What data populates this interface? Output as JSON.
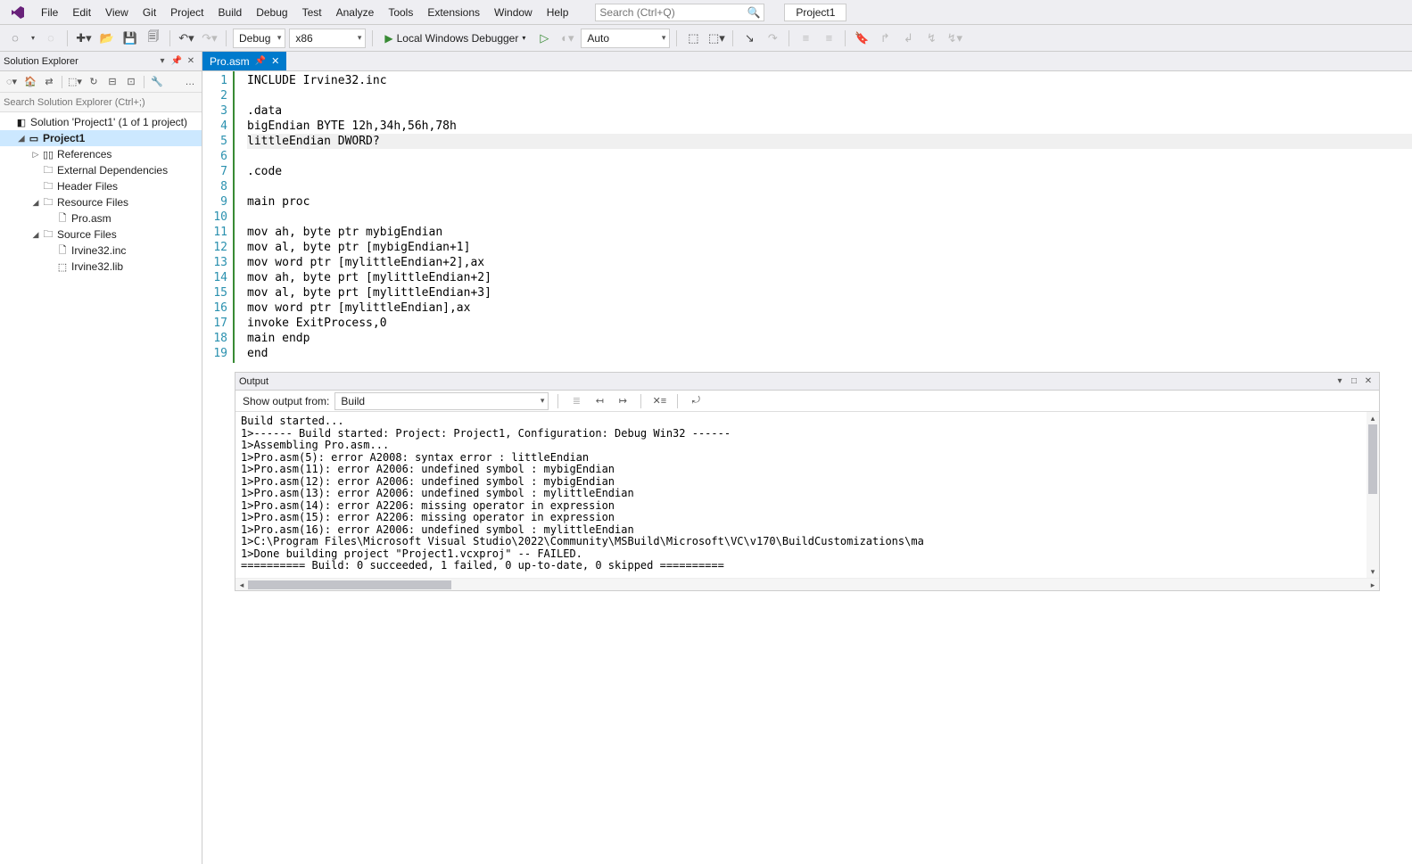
{
  "menu": [
    "File",
    "Edit",
    "View",
    "Git",
    "Project",
    "Build",
    "Debug",
    "Test",
    "Analyze",
    "Tools",
    "Extensions",
    "Window",
    "Help"
  ],
  "search": {
    "placeholder": "Search (Ctrl+Q)"
  },
  "project_name": "Project1",
  "toolbar": {
    "config": "Debug",
    "platform": "x86",
    "debugger": "Local Windows Debugger",
    "auto": "Auto"
  },
  "solution_explorer": {
    "title": "Solution Explorer",
    "search_placeholder": "Search Solution Explorer (Ctrl+;)",
    "tree": [
      {
        "level": 0,
        "exp": "",
        "icon": "◧",
        "label": "Solution 'Project1' (1 of 1 project)",
        "bold": false,
        "selected": false
      },
      {
        "level": 1,
        "exp": "◢",
        "icon": "▭",
        "label": "Project1",
        "bold": true,
        "selected": true
      },
      {
        "level": 2,
        "exp": "▷",
        "icon": "▯▯",
        "label": "References",
        "bold": false,
        "selected": false
      },
      {
        "level": 2,
        "exp": "",
        "icon": "🗀",
        "label": "External Dependencies",
        "bold": false,
        "selected": false
      },
      {
        "level": 2,
        "exp": "",
        "icon": "🗀",
        "label": "Header Files",
        "bold": false,
        "selected": false
      },
      {
        "level": 2,
        "exp": "◢",
        "icon": "🗀",
        "label": "Resource Files",
        "bold": false,
        "selected": false
      },
      {
        "level": 3,
        "exp": "",
        "icon": "🗋",
        "label": "Pro.asm",
        "bold": false,
        "selected": false
      },
      {
        "level": 2,
        "exp": "◢",
        "icon": "🗀",
        "label": "Source Files",
        "bold": false,
        "selected": false
      },
      {
        "level": 3,
        "exp": "",
        "icon": "🗋",
        "label": "Irvine32.inc",
        "bold": false,
        "selected": false
      },
      {
        "level": 3,
        "exp": "",
        "icon": "⬚",
        "label": "Irvine32.lib",
        "bold": false,
        "selected": false
      }
    ]
  },
  "tab": {
    "name": "Pro.asm"
  },
  "code": {
    "current_line": 5,
    "lines": [
      "INCLUDE Irvine32.inc",
      "",
      ".data",
      "bigEndian BYTE 12h,34h,56h,78h",
      "littleEndian DWORD?",
      "",
      ".code",
      "",
      "main proc",
      "",
      "mov ah, byte ptr mybigEndian",
      "mov al, byte ptr [mybigEndian+1]",
      "mov word ptr [mylittleEndian+2],ax",
      "mov ah, byte prt [mylittleEndian+2]",
      "mov al, byte prt [mylittleEndian+3]",
      "mov word ptr [mylittleEndian],ax",
      "invoke ExitProcess,0",
      "main endp",
      "end"
    ]
  },
  "output": {
    "title": "Output",
    "show_from_label": "Show output from:",
    "source": "Build",
    "lines": [
      "Build started...",
      "1>------ Build started: Project: Project1, Configuration: Debug Win32 ------",
      "1>Assembling Pro.asm...",
      "1>Pro.asm(5): error A2008: syntax error : littleEndian",
      "1>Pro.asm(11): error A2006: undefined symbol : mybigEndian",
      "1>Pro.asm(12): error A2006: undefined symbol : mybigEndian",
      "1>Pro.asm(13): error A2006: undefined symbol : mylittleEndian",
      "1>Pro.asm(14): error A2206: missing operator in expression",
      "1>Pro.asm(15): error A2206: missing operator in expression",
      "1>Pro.asm(16): error A2006: undefined symbol : mylittleEndian",
      "1>C:\\Program Files\\Microsoft Visual Studio\\2022\\Community\\MSBuild\\Microsoft\\VC\\v170\\BuildCustomizations\\ma",
      "1>Done building project \"Project1.vcxproj\" -- FAILED.",
      "========== Build: 0 succeeded, 1 failed, 0 up-to-date, 0 skipped =========="
    ]
  }
}
